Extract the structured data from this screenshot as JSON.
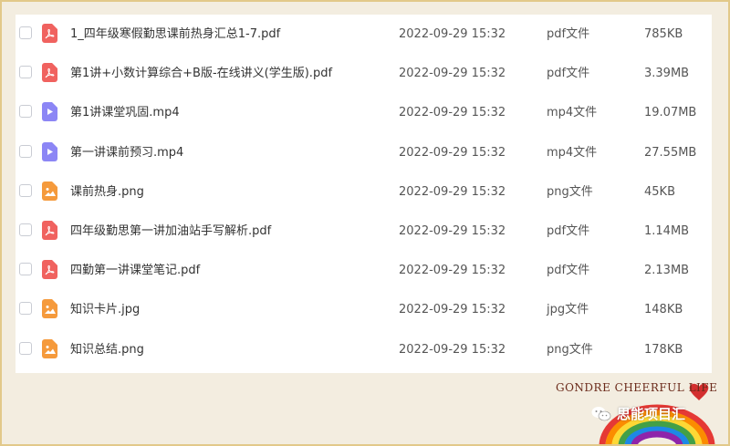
{
  "files": [
    {
      "name": "1_四年级寒假勤思课前热身汇总1-7.pdf",
      "date": "2022-09-29 15:32",
      "type": "pdf文件",
      "size": "785KB",
      "icon": "pdf-icon"
    },
    {
      "name": "第1讲+小数计算综合+B版-在线讲义(学生版).pdf",
      "date": "2022-09-29 15:32",
      "type": "pdf文件",
      "size": "3.39MB",
      "icon": "pdf-icon"
    },
    {
      "name": "第1讲课堂巩固.mp4",
      "date": "2022-09-29 15:32",
      "type": "mp4文件",
      "size": "19.07MB",
      "icon": "video-icon"
    },
    {
      "name": "第一讲课前预习.mp4",
      "date": "2022-09-29 15:32",
      "type": "mp4文件",
      "size": "27.55MB",
      "icon": "video-icon"
    },
    {
      "name": "课前热身.png",
      "date": "2022-09-29 15:32",
      "type": "png文件",
      "size": "45KB",
      "icon": "image-icon"
    },
    {
      "name": "四年级勤思第一讲加油站手写解析.pdf",
      "date": "2022-09-29 15:32",
      "type": "pdf文件",
      "size": "1.14MB",
      "icon": "pdf-icon"
    },
    {
      "name": "四勤第一讲课堂笔记.pdf",
      "date": "2022-09-29 15:32",
      "type": "pdf文件",
      "size": "2.13MB",
      "icon": "pdf-icon"
    },
    {
      "name": "知识卡片.jpg",
      "date": "2022-09-29 15:32",
      "type": "jpg文件",
      "size": "148KB",
      "icon": "image-icon"
    },
    {
      "name": "知识总结.png",
      "date": "2022-09-29 15:32",
      "type": "png文件",
      "size": "178KB",
      "icon": "image-icon"
    }
  ],
  "decoration": {
    "brand_text": "GONDRE CHEERFUL LIFE",
    "account_name": "思能项目汇"
  },
  "colors": {
    "pdf": "#f0625f",
    "video": "#8c86f5",
    "image": "#f59a3c",
    "frame": "#e2c98a"
  }
}
